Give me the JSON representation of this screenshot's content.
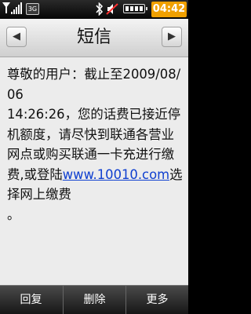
{
  "status_bar": {
    "network": "3G",
    "bluetooth_icon": "bluetooth-icon",
    "vibrate_icon": "vibrate-silent-icon",
    "battery_icon": "battery-icon",
    "time": "04:42"
  },
  "header": {
    "title": "短信",
    "prev_icon": "◀",
    "next_icon": "▶"
  },
  "message": {
    "lines": [
      "尊敬的用户：截止至2",
      "009/08/06",
      "14:26:26，您的话费已",
      "接近停机额度，请尽",
      "快到联通各营业网点",
      "或购买联通一卡充进",
      "行缴费,或登陆",
      "010.com选择网上缴费",
      "。"
    ],
    "link_part_1": "www.10",
    "link_part_2": "010.com",
    "after_link": "选择网上缴费"
  },
  "softkeys": {
    "reply": "回复",
    "delete": "删除",
    "more": "更多"
  },
  "colors": {
    "clock_bg": "#f0a000",
    "link": "#1040d0"
  }
}
